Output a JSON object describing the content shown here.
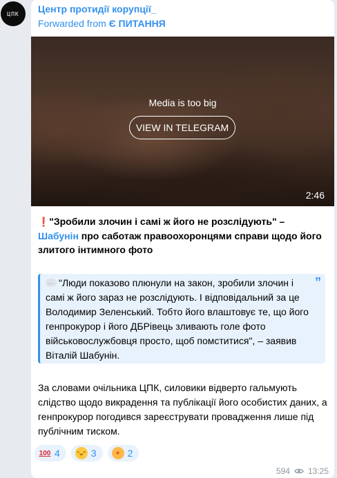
{
  "avatar": {
    "text": "ЦПК"
  },
  "post": {
    "channel_name": "Центр протидії корупції_",
    "forwarded_prefix": "Forwarded from ",
    "forwarded_source": "Є ПИТАННЯ",
    "media": {
      "notice": "Media is too big",
      "button_label": "VIEW IN TELEGRAM",
      "duration": "2:46"
    },
    "headline": {
      "mark": "❗",
      "quote": "\"Зробили злочин і самі ж його не розслідують\"",
      "dash": " – ",
      "mention": "Шабунін",
      "rest": " про саботаж правоохоронцями справи щодо його злитого інтимного фото"
    },
    "quote_block": {
      "text": "\"Люди показово плюнули на закон, зробили злочин і самі ж його зараз не розслідують. І відповідальний за це Володимир Зеленський. Тобто його влаштовує те, що його генпрокурор і його ДБРівець зливають голе фото військовослужбовця просто, щоб помститися\", – заявив Віталій Шабунін.",
      "quote_icon": "”"
    },
    "body": "За словами очільника ЦПК, силовики відверто гальмують слідство щодо викрадення та публікації його особистих даних, а генпрокурор погодився зареєструвати провадження лише під публічним тиском.",
    "reactions": [
      {
        "icon": "hundred-points-emoji",
        "glyph": "100",
        "count": "4"
      },
      {
        "icon": "grinning-face-emoji",
        "glyph": "ᵔᴗᵔ",
        "count": "3"
      },
      {
        "icon": "exploding-head-emoji",
        "glyph": "✶",
        "count": "2"
      }
    ],
    "views": "594",
    "time": "13:25"
  },
  "colors": {
    "accent": "#3390ec",
    "background": "#e7ebf0",
    "quote_background": "#e8f2fd"
  }
}
